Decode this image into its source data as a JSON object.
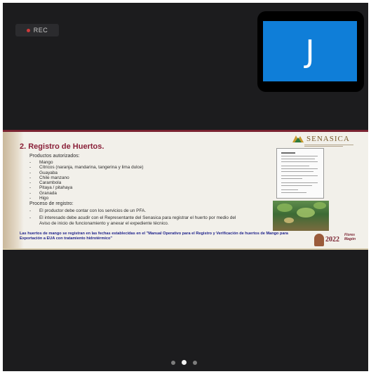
{
  "recording": {
    "label": "REC"
  },
  "participant": {
    "initial": "J",
    "tile_color": "#0f7ed8"
  },
  "slide": {
    "logo_text": "SENASICA",
    "title": "2. Registro de Huertos.",
    "products_heading": "Productos autorizados:",
    "products": [
      "Mango",
      "Cítricos (naranja, mandarina, tangerina y lima dulce)",
      "Guayaba",
      "Chile manzano",
      "Carambola",
      "Pitaya / pitahaya",
      "Granada",
      "Higo"
    ],
    "process_heading": "Proceso de registro:",
    "process_steps": [
      "El productor debe contar con los servicios de un PFA.",
      "El interesado debe acudir con el Representante del Senasica para registrar el huerto por medio del Aviso de inicio de funcionamiento y anexar el expediente técnico."
    ],
    "footer": "Las huertos de mango se registran en las fechas establecidas en el \"Manual Operativo para el Registro y Verificación de huertos de Mango para Exportación a EUA con tratamiento hidrotérmico\"",
    "badge_year": "2022",
    "badge_text": "Flores Magón",
    "accent_color": "#8a1f38",
    "footer_color": "#1b1f8a"
  },
  "pager": {
    "pages": 3,
    "active_index": 1
  }
}
